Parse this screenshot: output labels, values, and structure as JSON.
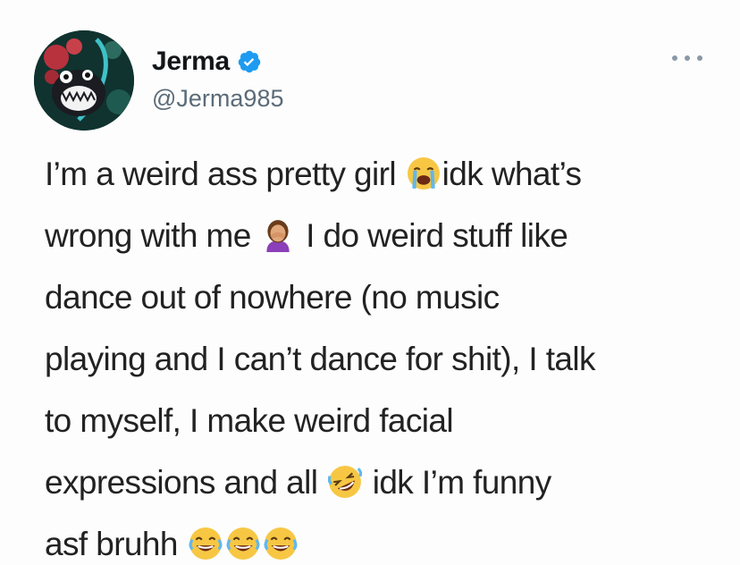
{
  "author": {
    "display_name": "Jerma",
    "handle": "@Jerma985",
    "verified": true
  },
  "icons": {
    "verified": "verified-badge-icon",
    "more": "more-options-icon"
  },
  "colors": {
    "verified_blue": "#1d9bf0",
    "handle_gray": "#5b6b78",
    "text": "#222222"
  },
  "tweet": {
    "line1_a": "I’m a weird ass pretty girl ",
    "emoji1": "crying-face-emoji",
    "line1_b": "idk what’s",
    "line2_a": "wrong with me ",
    "emoji2": "person-facepalming-emoji",
    "line2_b": " I do weird stuff like",
    "line3": "dance out of nowhere (no music",
    "line4": "playing and I can’t dance for shit), I talk",
    "line5": "to myself, I make weird facial",
    "line6_a": "expressions and all ",
    "emoji3": "rolling-on-floor-laughing-emoji",
    "line6_b": " idk I’m funny",
    "line7_a": "asf bruhh ",
    "emoji4": "face-with-tears-of-joy-emoji"
  }
}
